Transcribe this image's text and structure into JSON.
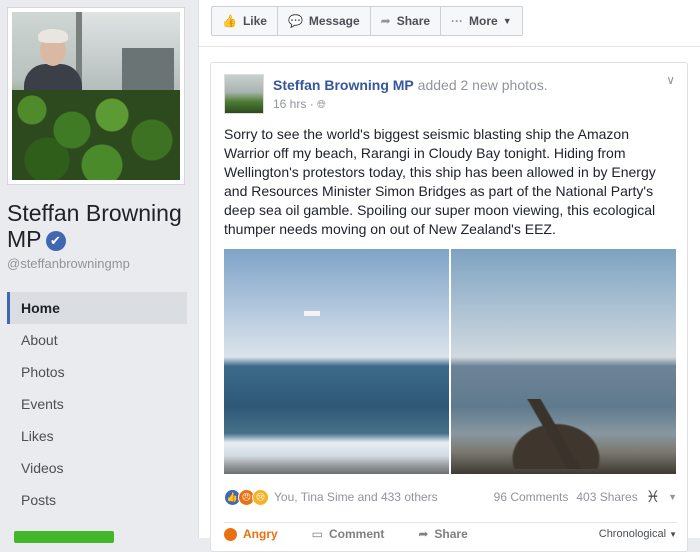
{
  "profile": {
    "name": "Steffan Browning MP",
    "handle": "@steffanbrowningmp",
    "verified_mark": "✔"
  },
  "nav": [
    {
      "label": "Home",
      "active": true
    },
    {
      "label": "About"
    },
    {
      "label": "Photos"
    },
    {
      "label": "Events"
    },
    {
      "label": "Likes"
    },
    {
      "label": "Videos"
    },
    {
      "label": "Posts"
    }
  ],
  "actionbar": {
    "like": "Like",
    "message": "Message",
    "share": "Share",
    "more": "More"
  },
  "post": {
    "author": "Steffan Browning MP",
    "action": "added 2 new photos.",
    "time": "16 hrs",
    "text": "Sorry to see the world's biggest seismic blasting ship the Amazon Warrior off my beach, Rarangi in Cloudy Bay tonight. Hiding from Wellington's protestors today, this ship has been allowed in by Energy and Resources Minister Simon Bridges as part of the National Party's deep sea oil gamble. Spoiling our super moon viewing, this ecological thumper needs moving on out of New Zealand's EEZ.",
    "reactions_text": "You, Tina Sime and 433 others",
    "comments": "96 Comments",
    "shares": "403 Shares",
    "action_reaction": "Angry",
    "action_comment": "Comment",
    "action_share": "Share",
    "sort": "Chronological"
  },
  "colors": {
    "link": "#365899",
    "accent": "#4267b2",
    "angry": "#e9710f",
    "green": "#42b72a"
  }
}
